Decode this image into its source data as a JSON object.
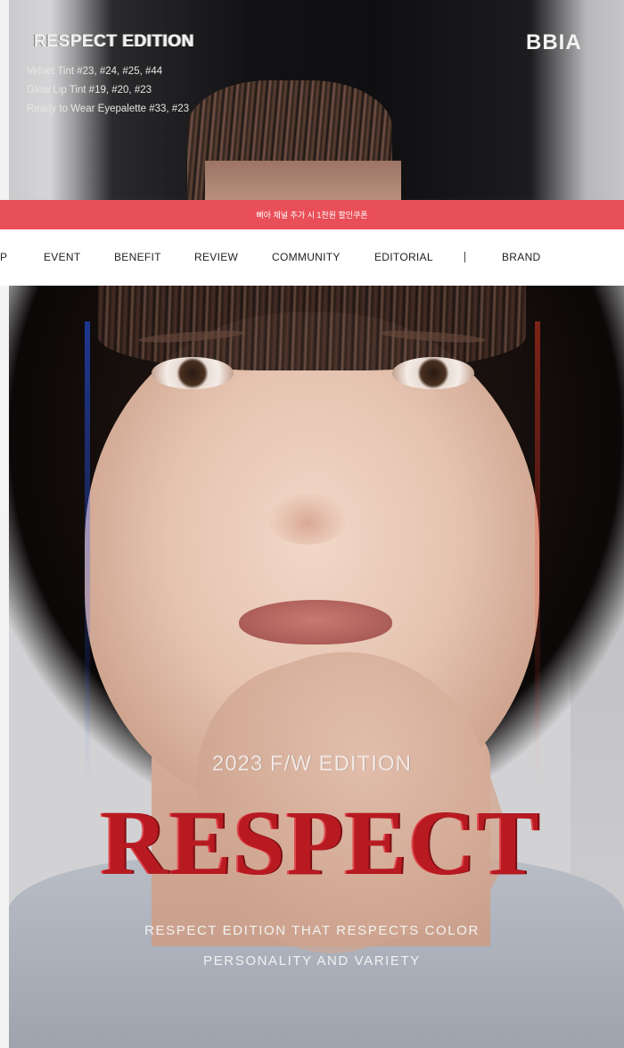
{
  "top_banner": {
    "title": "RESPECT EDITION",
    "items": [
      "Velvet Tint #23, #24, #25, #44",
      "Glow Lip Tint #19, #20, #23",
      "Ready to Wear Eyepalette #33, #23"
    ],
    "brand_logo": "BBIA"
  },
  "promo": {
    "text": "삐아 채널 추가 시 1천원 할인쿠폰"
  },
  "nav": {
    "items": [
      "P",
      "EVENT",
      "BENEFIT",
      "REVIEW",
      "COMMUNITY",
      "EDITORIAL",
      "BRAND"
    ]
  },
  "main_banner": {
    "edition": "2023 F/W EDITION",
    "headline": "RESPECT",
    "tagline_1": "RESPECT EDITION THAT RESPECTS COLOR",
    "tagline_2": "PERSONALITY AND VARIETY"
  },
  "colors": {
    "promo_bg": "#e94f58",
    "headline": "#b81a22"
  }
}
